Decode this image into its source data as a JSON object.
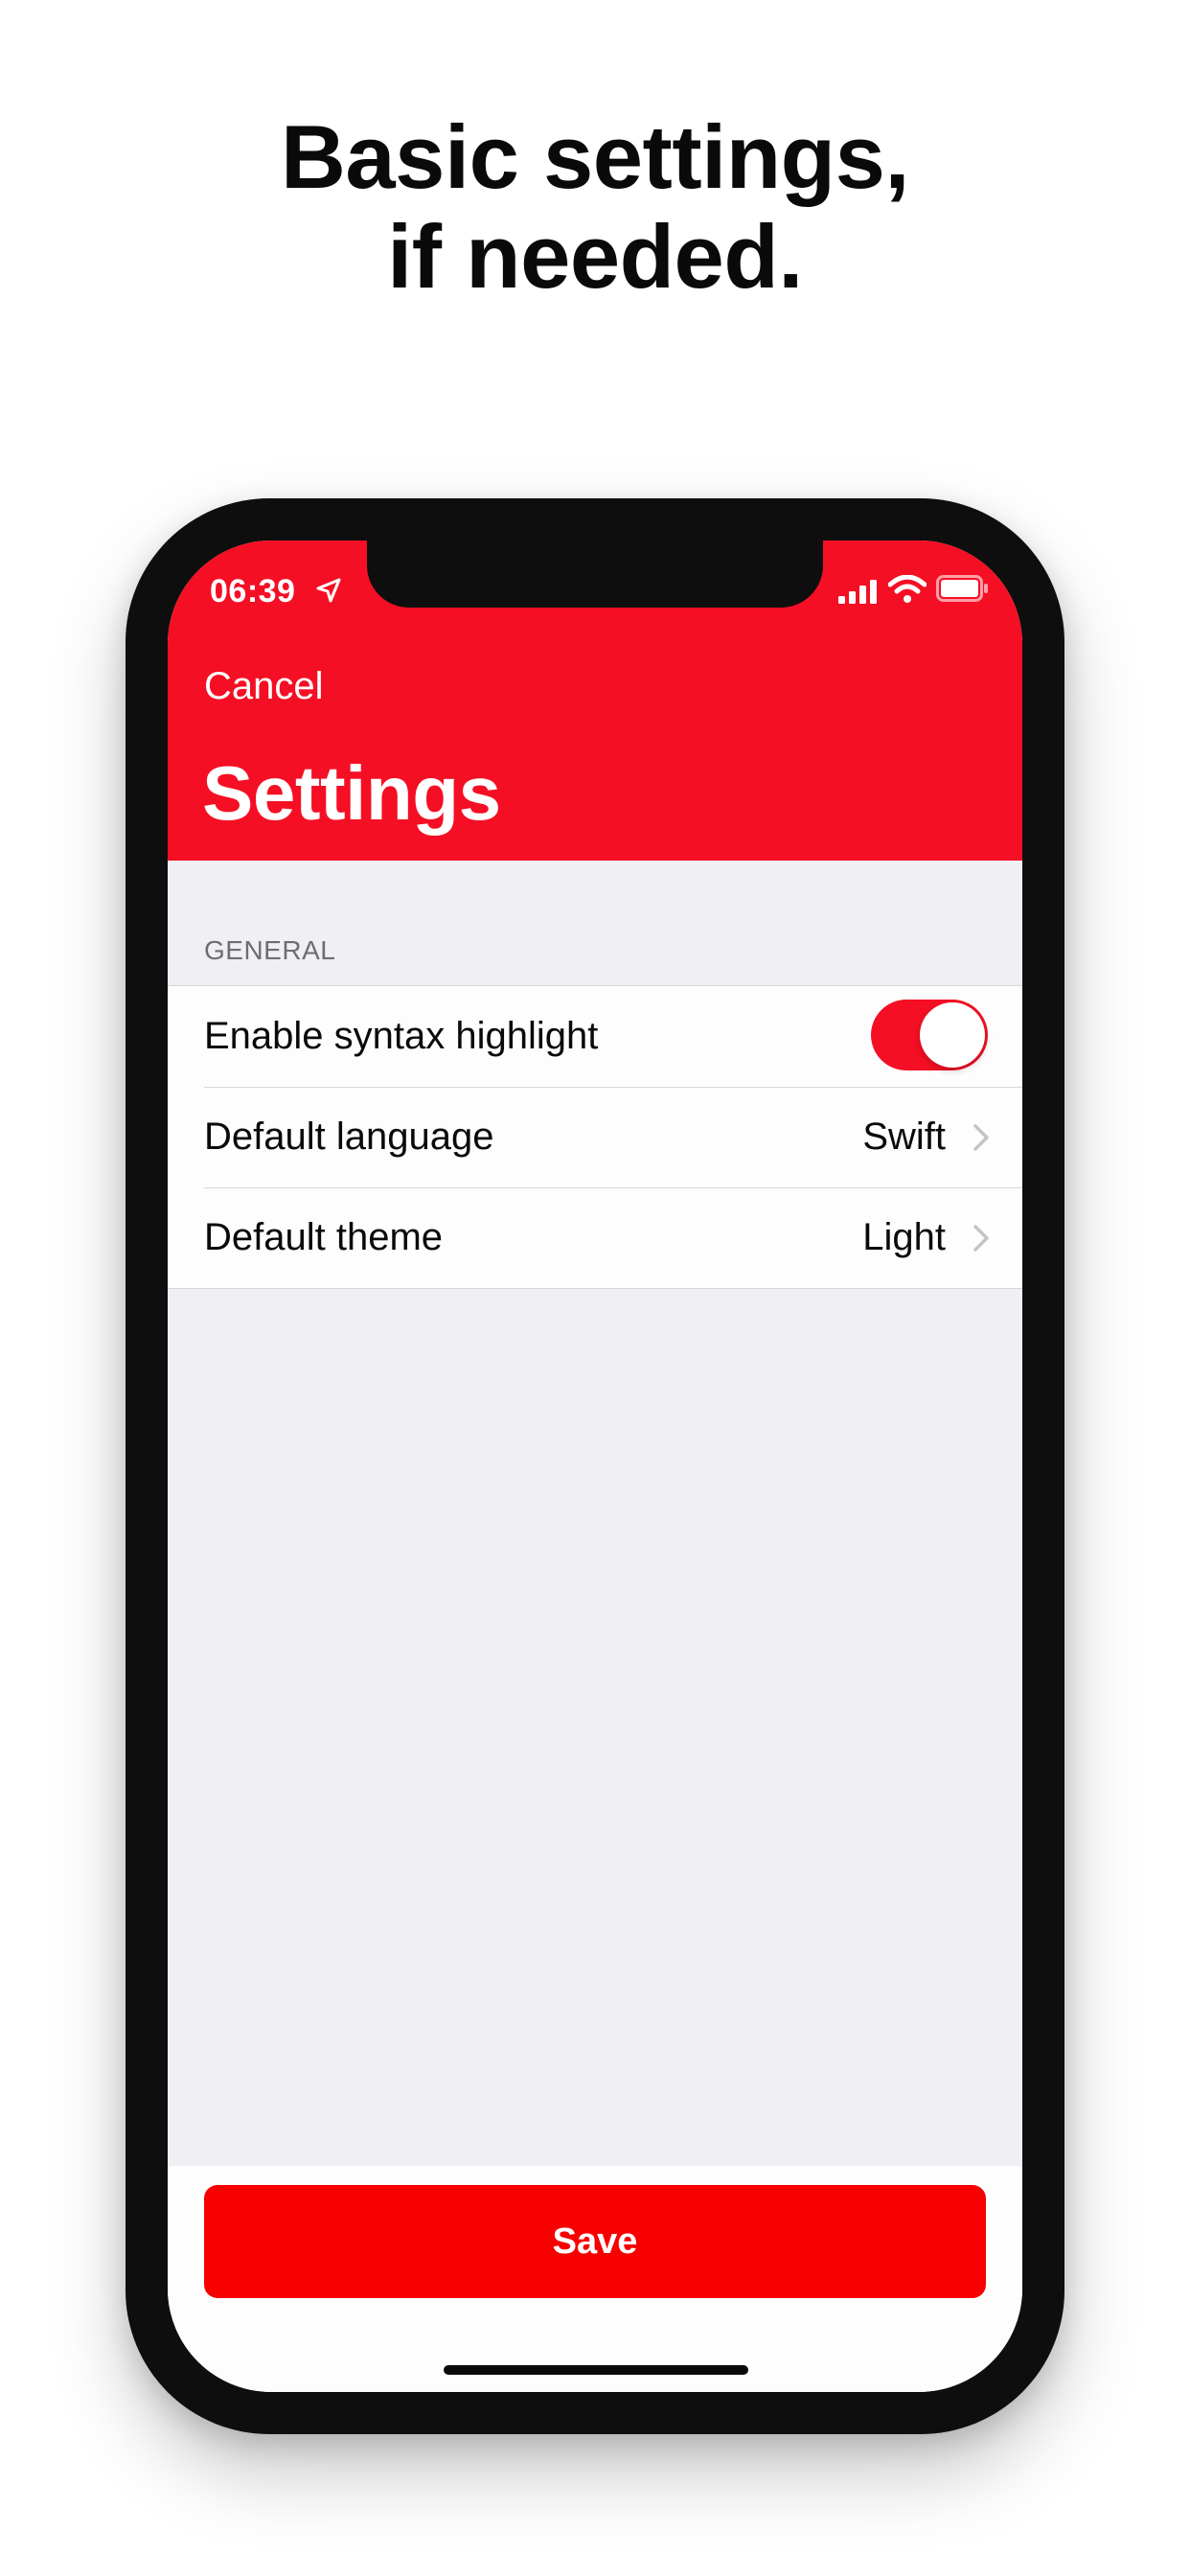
{
  "headline": {
    "line1": "Basic settings,",
    "line2": "if needed."
  },
  "status_bar": {
    "time": "06:39",
    "icons": [
      "location-arrow-icon",
      "cellular-signal-icon",
      "wifi-icon",
      "battery-icon"
    ]
  },
  "nav": {
    "cancel_label": "Cancel",
    "title": "Settings"
  },
  "general_section": {
    "header": "GENERAL",
    "rows": [
      {
        "label": "Enable syntax highlight",
        "type": "toggle",
        "enabled": true
      },
      {
        "label": "Default language",
        "value": "Swift",
        "type": "disclosure"
      },
      {
        "label": "Default theme",
        "value": "Light",
        "type": "disclosure"
      }
    ]
  },
  "footer": {
    "save_label": "Save"
  },
  "colors": {
    "brand_red": "#f50f24",
    "save_red": "#f60000",
    "background": "#efeff4",
    "section_header": "#6d6d72"
  }
}
